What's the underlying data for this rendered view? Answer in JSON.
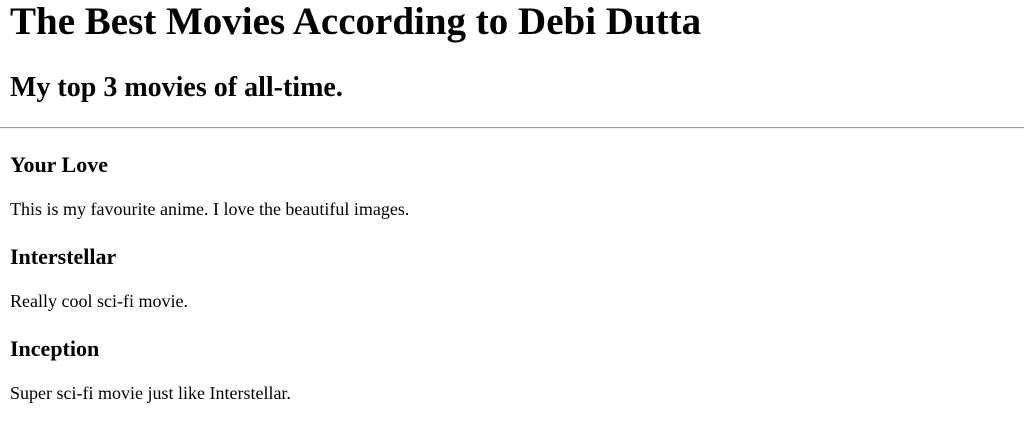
{
  "page": {
    "title": "The Best Movies According to Debi Dutta",
    "subtitle": "My top 3 movies of all-time."
  },
  "movies": [
    {
      "title": "Your Love",
      "description": "This is my favourite anime. I love the beautiful images."
    },
    {
      "title": "Interstellar",
      "description": "Really cool sci-fi movie."
    },
    {
      "title": "Inception",
      "description": "Super sci-fi movie just like Interstellar."
    }
  ]
}
